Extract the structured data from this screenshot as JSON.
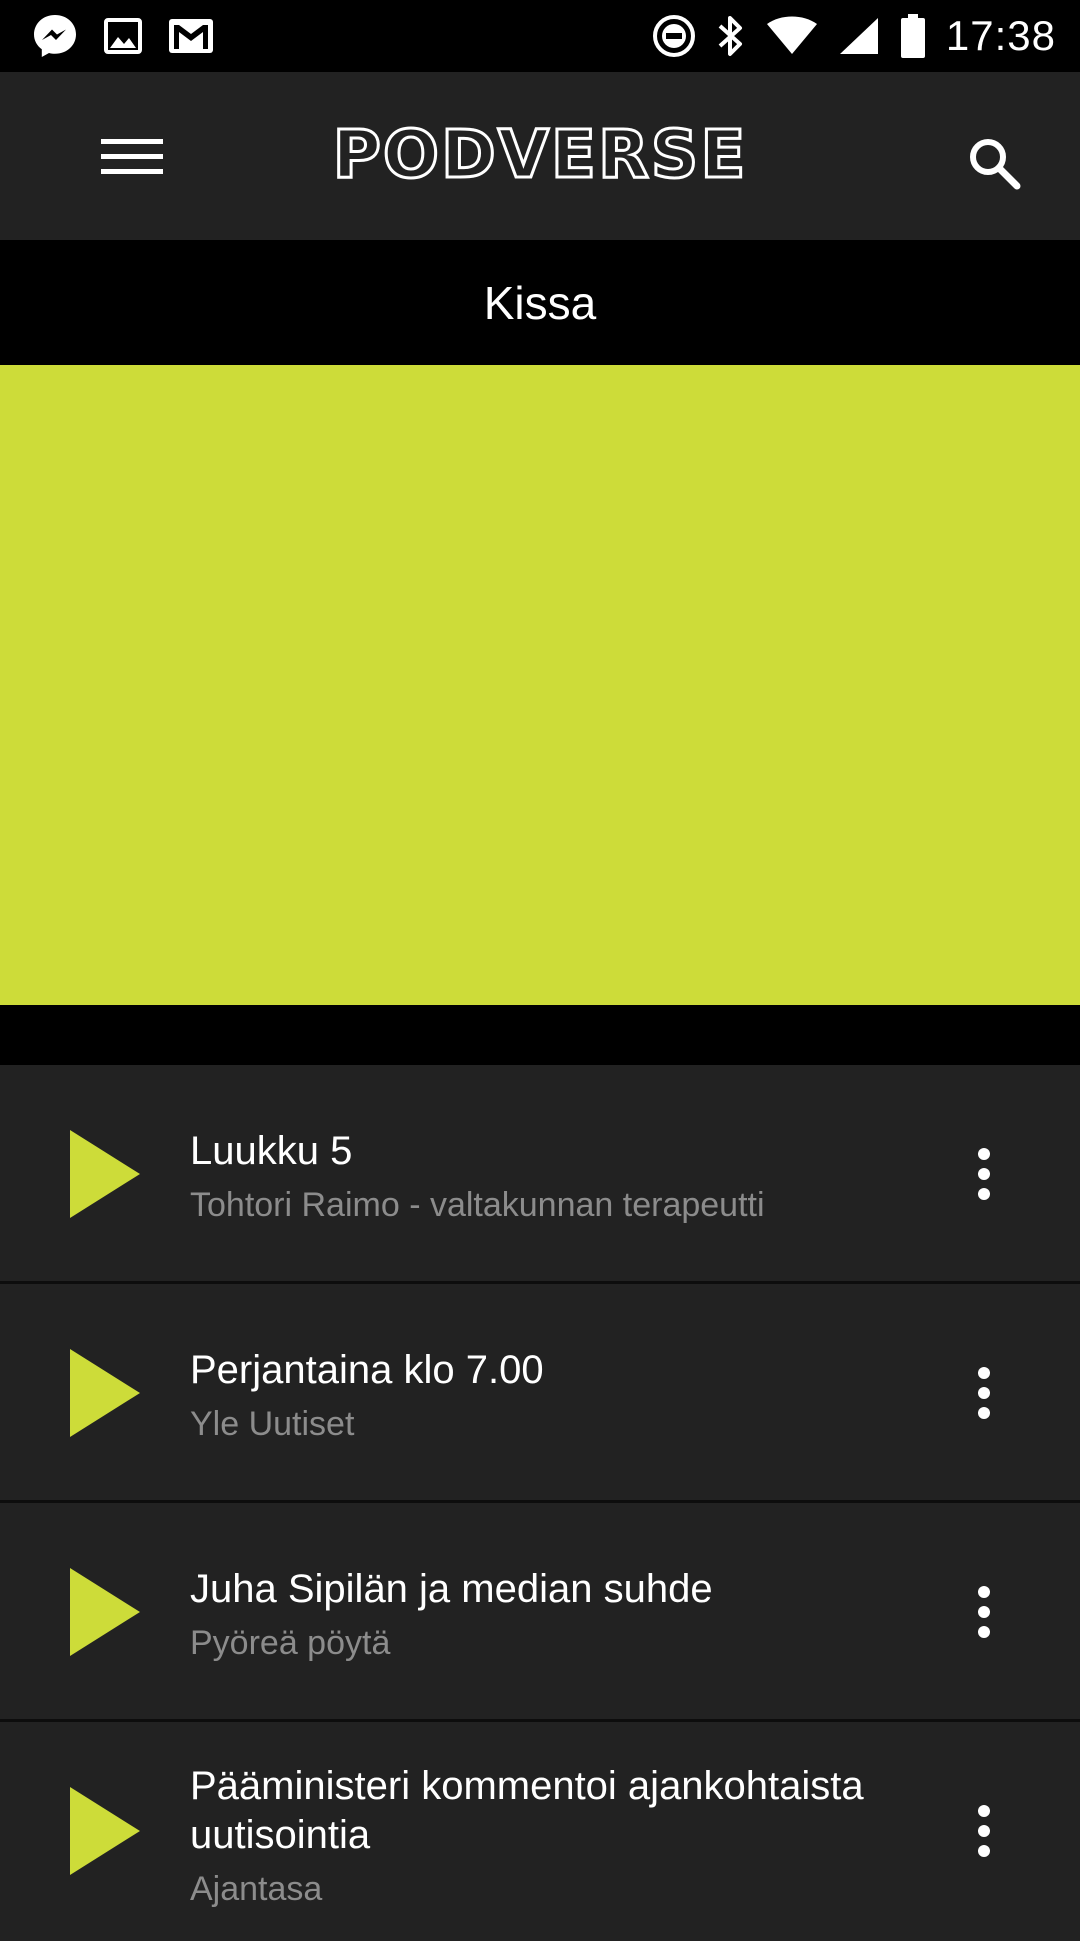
{
  "status_bar": {
    "time": "17:38",
    "left_icons": [
      "messenger-icon",
      "image-icon",
      "gmail-icon"
    ],
    "right_icons": [
      "do-not-disturb-icon",
      "bluetooth-icon",
      "wifi-icon",
      "cell-signal-icon",
      "battery-icon"
    ]
  },
  "app_bar": {
    "logo": "PODVERSE",
    "menu_icon": "hamburger-menu-icon",
    "search_icon": "search-icon"
  },
  "page": {
    "title": "Kissa"
  },
  "artwork": {
    "color": "#CDDC39"
  },
  "colors": {
    "accent": "#CDDC39",
    "row_bg": "#222222",
    "subtitle": "#8C8C8C"
  },
  "episodes": [
    {
      "title": "Luukku 5",
      "subtitle": "Tohtori Raimo - valtakunnan terapeutti"
    },
    {
      "title": "Perjantaina klo 7.00",
      "subtitle": "Yle Uutiset"
    },
    {
      "title": "Juha Sipilän ja median suhde",
      "subtitle": "Pyöreä pöytä"
    },
    {
      "title": "Pääministeri kommentoi ajankohtaista uutisointia",
      "subtitle": "Ajantasa"
    }
  ]
}
